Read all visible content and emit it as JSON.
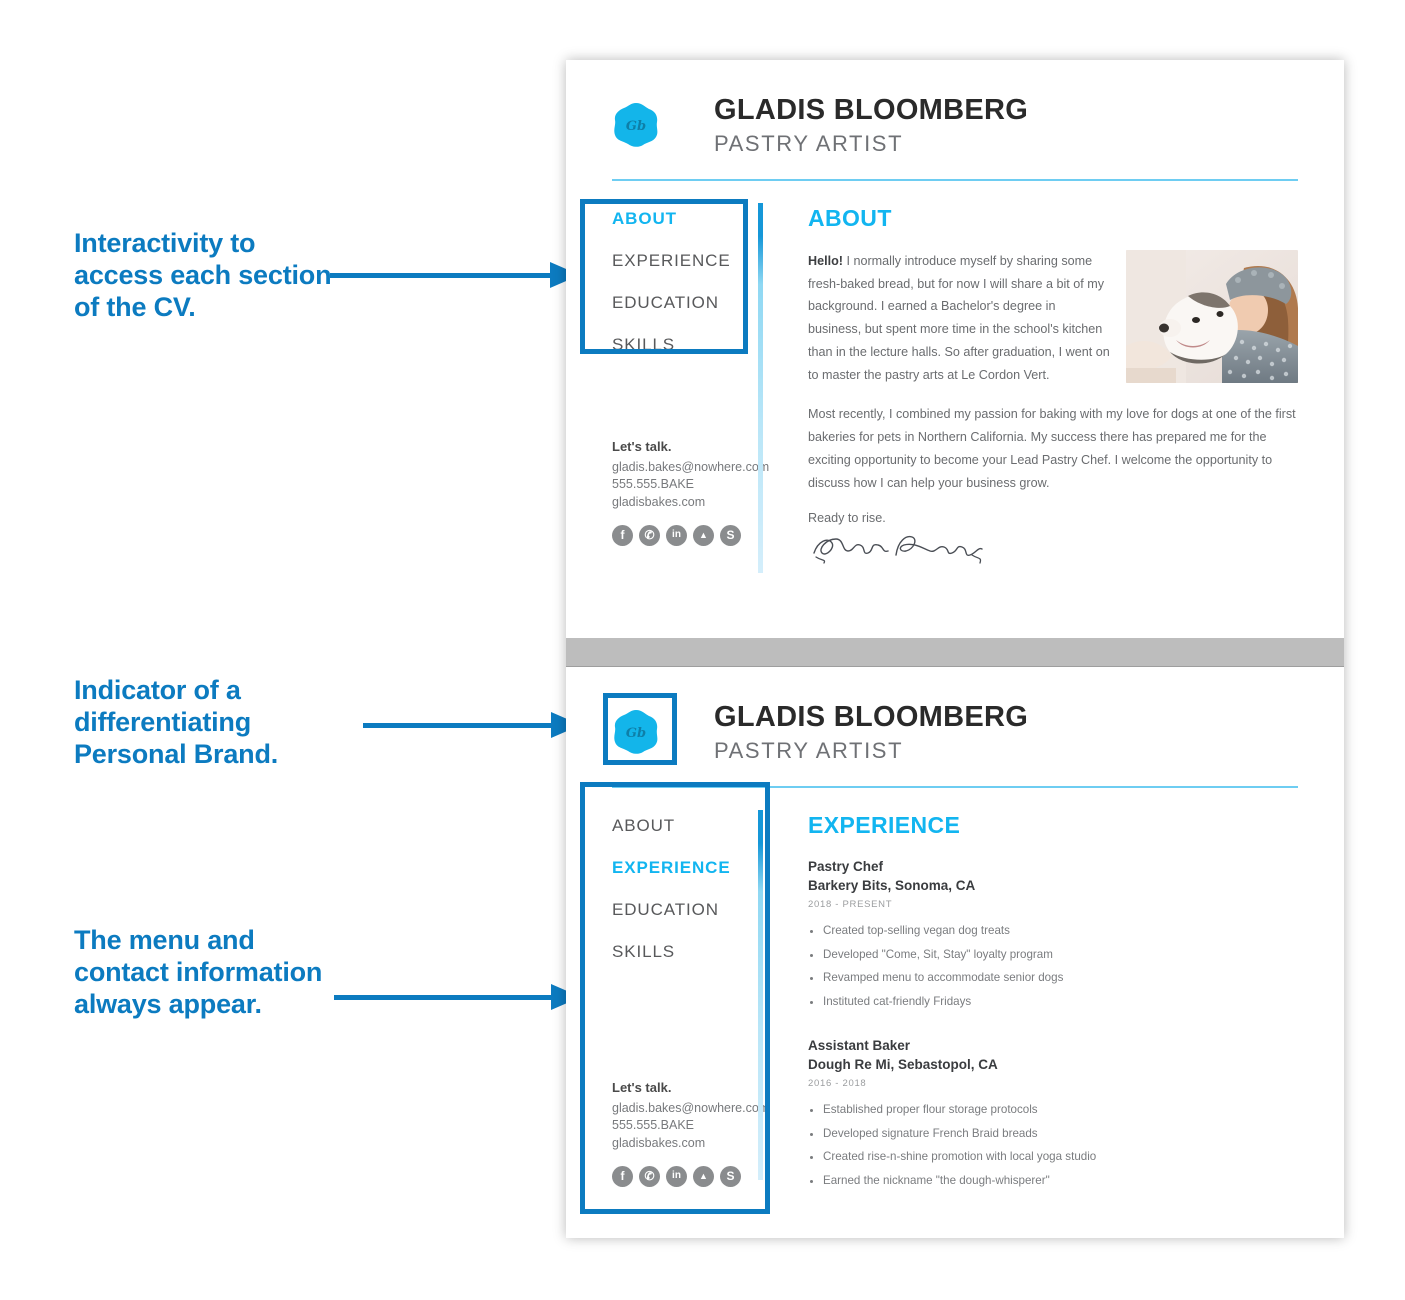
{
  "annotations": [
    {
      "id": "a1",
      "text": "Interactivity to access each section of the CV."
    },
    {
      "id": "a2",
      "text": "Indicator of a differentiating Personal Brand."
    },
    {
      "id": "a3",
      "text": "The menu and contact information always appear."
    }
  ],
  "colors": {
    "annotation_blue": "#0C7BC0",
    "accent_cyan": "#12B5F0",
    "rule_light_blue": "#6ECDF2",
    "divider_gray": "#BDBDBD",
    "body_text": "#6A6C6F",
    "heading_text": "#2A2A2A"
  },
  "cv": {
    "logo_initials": "Gb",
    "name": "GLADIS BLOOMBERG",
    "role": "PASTRY ARTIST",
    "nav": [
      {
        "label": "ABOUT"
      },
      {
        "label": "EXPERIENCE"
      },
      {
        "label": "EDUCATION"
      },
      {
        "label": "SKILLS"
      }
    ],
    "contact": {
      "title": "Let's talk.",
      "email": "gladis.bakes@nowhere.com",
      "phone": "555.555.BAKE",
      "website": "gladisbakes.com",
      "social": [
        {
          "name": "facebook-icon",
          "glyph": "f"
        },
        {
          "name": "twitter-icon",
          "glyph": "✆"
        },
        {
          "name": "linkedin-icon",
          "glyph": "in"
        },
        {
          "name": "behance-icon",
          "glyph": "▲"
        },
        {
          "name": "skype-icon",
          "glyph": "S"
        }
      ]
    }
  },
  "panel_top": {
    "active_nav": "ABOUT",
    "section_title": "ABOUT",
    "paragraph_1_lead": "Hello!",
    "paragraph_1": " I normally introduce myself by sharing some fresh-baked bread, but for now I will share a bit of my background. I earned a Bachelor's degree in business, but spent more time in the school's kitchen than in the lecture halls. So after graduation, I went on to master the pastry arts at Le Cordon Vert.",
    "paragraph_2": "Most recently, I combined my passion for baking with my love for dogs at one of the first bakeries for pets in Northern California. My success there has prepared me for the exciting opportunity to become your Lead Pastry Chef. I welcome the opportunity to discuss how I can help your business grow.",
    "closing": "Ready to rise.",
    "signature": "Gladis Bloomberg",
    "photo_alt": "woman-in-knit-hat-hugging-husky-dog"
  },
  "panel_bottom": {
    "active_nav": "EXPERIENCE",
    "section_title": "EXPERIENCE",
    "jobs": [
      {
        "title": "Pastry Chef",
        "place": "Barkery Bits, Sonoma, CA",
        "dates": "2018 - PRESENT",
        "bullets": [
          "Created top-selling vegan dog treats",
          "Developed \"Come, Sit, Stay\" loyalty program",
          "Revamped menu to accommodate senior dogs",
          "Instituted cat-friendly Fridays"
        ]
      },
      {
        "title": "Assistant Baker",
        "place": "Dough Re Mi, Sebastopol, CA",
        "dates": "2016 - 2018",
        "bullets": [
          "Established proper flour storage protocols",
          "Developed signature French Braid breads",
          "Created rise-n-shine promotion with local yoga studio",
          "Earned the nickname \"the dough-whisperer\""
        ]
      }
    ]
  }
}
